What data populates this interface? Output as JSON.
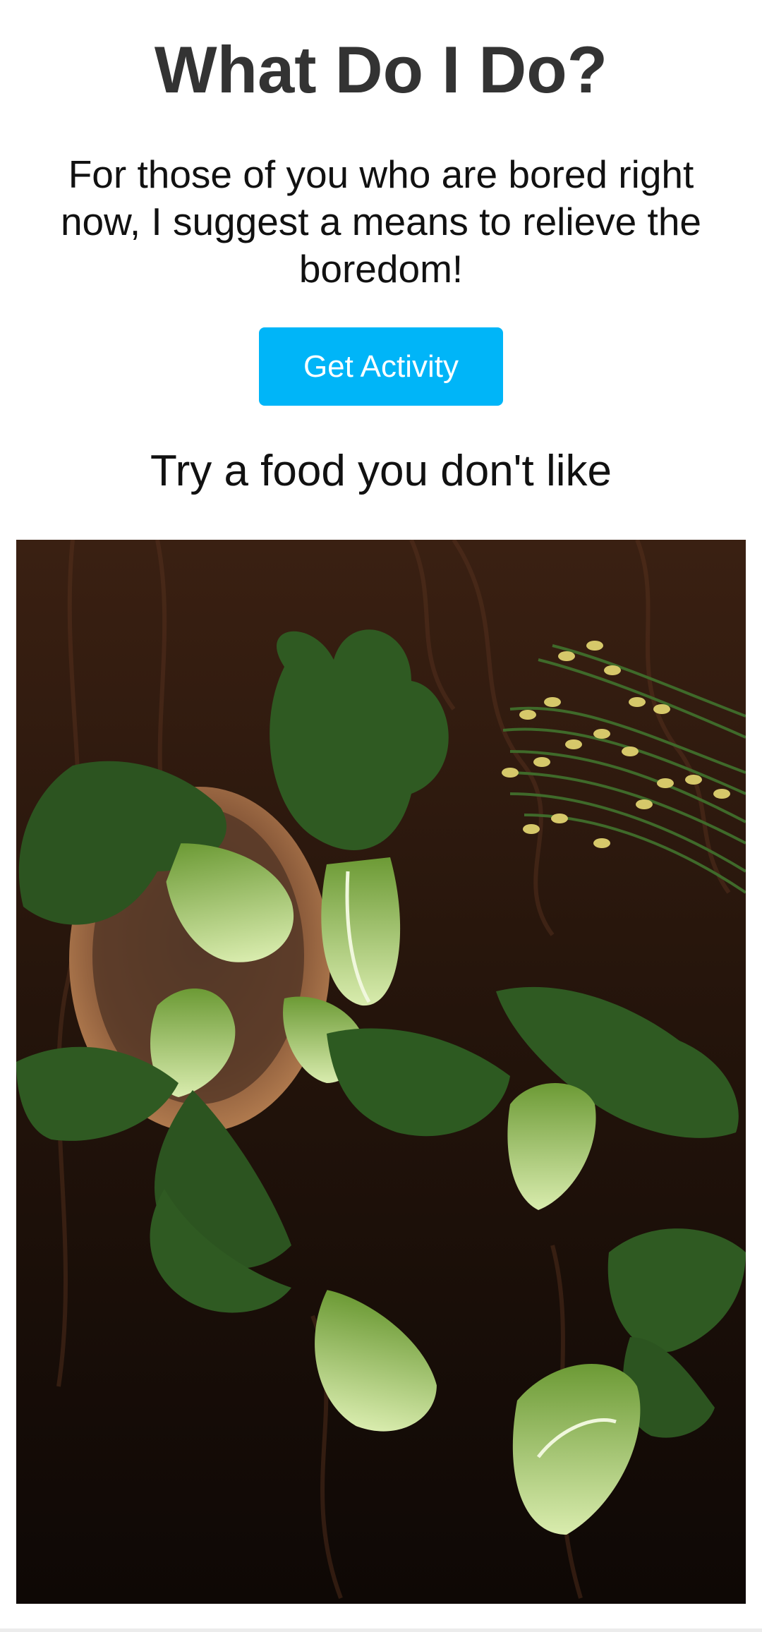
{
  "header": {
    "title": "What Do I Do?",
    "description": "For those of you who are bored right now, I suggest a means to relieve the boredom!"
  },
  "actions": {
    "get_activity_label": "Get Activity"
  },
  "result": {
    "activity": "Try a food you don't like"
  },
  "colors": {
    "button": "#00b5f8",
    "title": "#333333",
    "text": "#111111",
    "background": "#ffffff"
  }
}
